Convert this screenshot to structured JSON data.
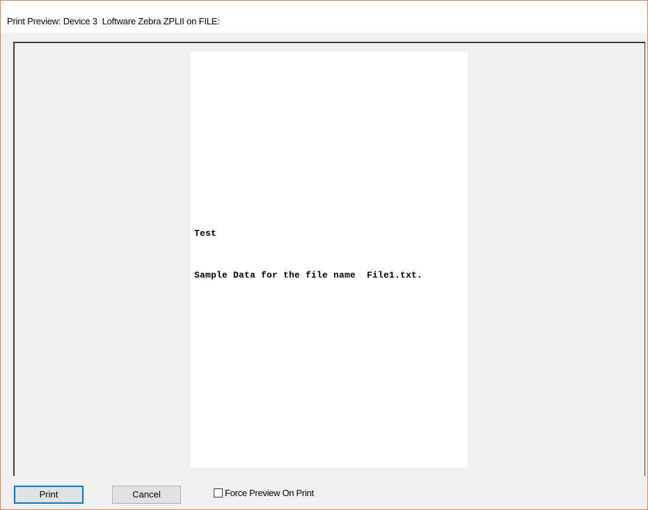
{
  "window": {
    "title": "Print Preview: Device 3  Loftware Zebra ZPLII on FILE:"
  },
  "preview": {
    "lines": [
      "Test",
      "Sample Data for the file name  File1.txt."
    ]
  },
  "buttons": {
    "print_label": "Print",
    "cancel_label": "Cancel"
  },
  "options": {
    "force_preview_label": "Force Preview On Print",
    "force_preview_checked": false
  },
  "colors": {
    "window_border": "#e8834f",
    "focus_border": "#0078d7",
    "dialog_background": "#f0f0f0"
  }
}
